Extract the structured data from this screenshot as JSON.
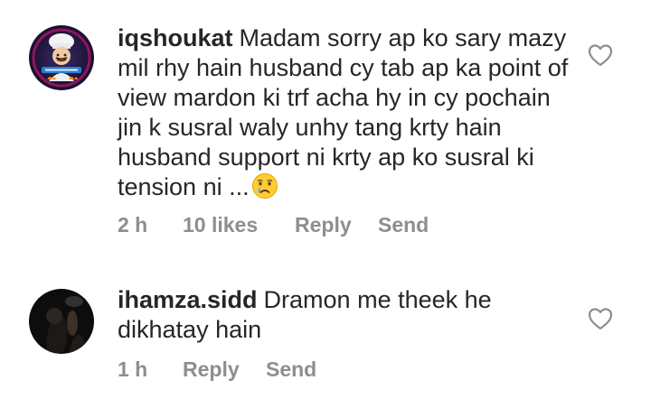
{
  "comments": [
    {
      "username": "iqshoukat",
      "text": "Madam sorry ap ko sary mazy mil rhy hain husband cy tab ap ka point of view mardon ki trf acha hy in cy pochain jin k susral waly unhy tang krty hain husband support ni krty ap ko susral ki tension ni ...",
      "emoji": "crying-face-emoji",
      "time": "2 h",
      "likes": "10 likes",
      "reply_label": "Reply",
      "send_label": "Send",
      "avatar": "chef-cartoon-avatar",
      "like_icon": "heart-outline-icon"
    },
    {
      "username": "ihamza.sidd",
      "text": "Dramon me theek he dikhatay hain",
      "time": "1 h",
      "reply_label": "Reply",
      "send_label": "Send",
      "avatar": "dark-photo-avatar",
      "like_icon": "heart-outline-icon"
    }
  ],
  "colors": {
    "text": "#262626",
    "meta": "#8e8e8e"
  }
}
